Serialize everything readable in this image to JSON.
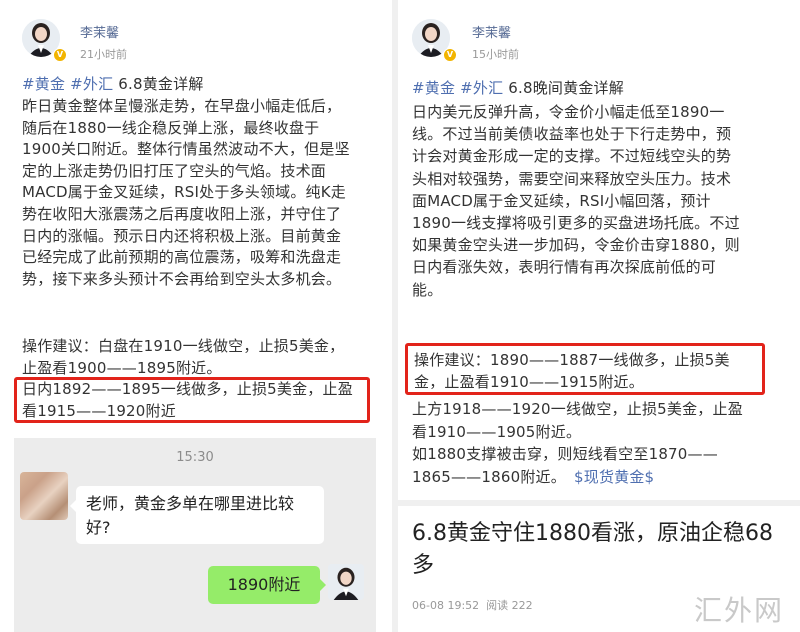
{
  "left_post": {
    "username": "李茉馨",
    "time": "21小时前",
    "tag1": "#黄金",
    "tag2": "#外汇",
    "title": "6.8黄金详解",
    "body": "昨日黄金整体呈慢涨走势，在早盘小幅走低后，\n随后在1880一线企稳反弹上涨，最终收盘于\n1900关口附近。整体行情虽然波动不大，但是坚\n定的上涨走势仍旧打压了空头的气焰。技术面\nMACD属于金叉延续，RSI处于多头领域。纯K走\n势在收阳大涨震荡之后再度收阳上涨，并守住了\n日内的涨幅。预示日内还将积极上涨。目前黄金\n已经完成了此前预期的高位震荡，吸筹和洗盘走\n势，接下来多头预计不会再给到空头太多机会。",
    "advice": "操作建议：白盘在1910一线做空，止损5美金，\n止盈看1900——1895附近。\n日内1892——1895一线做多，止损5美金，止盈\n看1915——1920附近"
  },
  "chat": {
    "time": "15:30",
    "incoming": "老师，黄金多单在哪里进比较好?",
    "outgoing": "1890附近"
  },
  "right_post": {
    "username": "李茉馨",
    "time": "15小时前",
    "tag1": "#黄金",
    "tag2": "#外汇",
    "title": "6.8晚间黄金详解",
    "body": "日内美元反弹升高，令金价小幅走低至1890一\n线。不过当前美债收益率也处于下行走势中，预\n计会对黄金形成一定的支撑。不过短线空头的势\n头相对较强势，需要空间来释放空头压力。技术\n面MACD属于金叉延续，RSI小幅回落，预计\n1890一线支撑将吸引更多的买盘进场托底。不过\n如果黄金空头进一步加码，令金价击穿1880，则\n日内看涨失效，表明行情有再次探底前低的可\n能。",
    "advice": "操作建议：1890——1887一线做多，止损5美\n金，止盈看1910——1915附近。",
    "advice2": "上方1918——1920一线做空，止损5美金，止盈\n看1910——1905附近。\n如1880支撑被击穿，则短线看空至1870——\n1865——1860附近。",
    "hashtag": "$现货黄金$"
  },
  "article": {
    "headline": "6.8黄金守住1880看涨，原油企稳68多",
    "date": "06-08 19:52",
    "reads": "阅读 222"
  },
  "watermark": "汇外网",
  "colors": {
    "accent_red": "#e2231a",
    "link_blue": "#4f6fb0",
    "chat_green": "#95ec69"
  }
}
